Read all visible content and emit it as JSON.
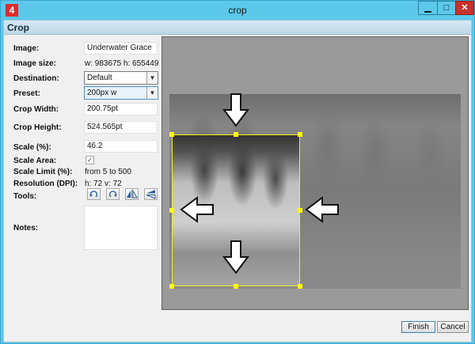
{
  "window": {
    "title": "crop",
    "app_icon_letter": "4",
    "controls": {
      "minimize": "▁",
      "maximize": "□",
      "close": "✕"
    }
  },
  "panel": {
    "title": "Crop"
  },
  "form": {
    "image_label": "Image:",
    "image_value": "Underwater Grace",
    "image_size_label": "Image size:",
    "image_size_value": "w: 983675 h: 655449",
    "destination_label": "Destination:",
    "destination_value": "Default",
    "preset_label": "Preset:",
    "preset_value": "200px w",
    "crop_width_label": "Crop Width:",
    "crop_width_value": "200.75pt",
    "crop_height_label": "Crop Height:",
    "crop_height_value": "524.565pt",
    "scale_label": "Scale (%):",
    "scale_value": "46.2",
    "scale_area_label": "Scale Area:",
    "scale_area_checked": true,
    "scale_limit_label": "Scale Limit (%):",
    "scale_limit_value": "from 5 to 500",
    "resolution_label": "Resolution (DPI):",
    "resolution_value": "h: 72 v: 72",
    "tools_label": "Tools:",
    "tools": [
      "rotate-left-icon",
      "rotate-right-icon",
      "flip-horizontal-icon",
      "flip-vertical-icon"
    ],
    "notes_label": "Notes:",
    "notes_value": ""
  },
  "buttons": {
    "finish": "Finish",
    "cancel": "Cancel"
  },
  "colors": {
    "titlebar": "#5cc8ea",
    "crop_border": "#f0ec1a",
    "close": "#c7312c"
  }
}
